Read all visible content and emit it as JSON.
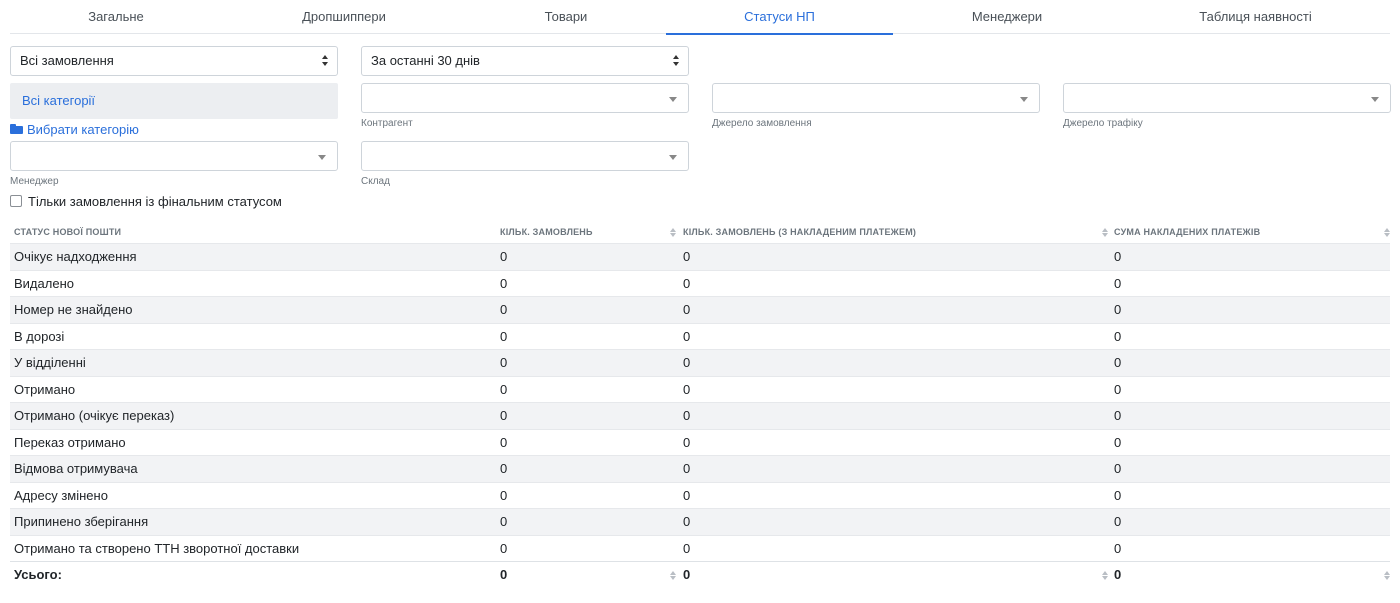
{
  "tabs": [
    {
      "label": "Загальне",
      "active": false
    },
    {
      "label": "Дропшиппери",
      "active": false
    },
    {
      "label": "Товари",
      "active": false
    },
    {
      "label": "Статуси НП",
      "active": true
    },
    {
      "label": "Менеджери",
      "active": false
    },
    {
      "label": "Таблиця наявності",
      "active": false
    }
  ],
  "filters": {
    "orders_select": "Всі замовлення",
    "period_select": "За останні 30 днів",
    "categories": "Всі категорії",
    "choose_category": "Вибрати категорію",
    "counterparty_label": "Контрагент",
    "order_source_label": "Джерело замовлення",
    "traffic_source_label": "Джерело трафіку",
    "manager_label": "Менеджер",
    "warehouse_label": "Склад",
    "final_status_checkbox": "Тільки замовлення із фінальним статусом"
  },
  "table": {
    "columns": [
      "Статус нової пошти",
      "Кільк. замовлень",
      "Кільк. замовлень (з накладеним платежем)",
      "Сума накладених платежів"
    ],
    "rows": [
      [
        "Очікує надходження",
        "0",
        "0",
        "0"
      ],
      [
        "Видалено",
        "0",
        "0",
        "0"
      ],
      [
        "Номер не знайдено",
        "0",
        "0",
        "0"
      ],
      [
        "В дорозі",
        "0",
        "0",
        "0"
      ],
      [
        "У відділенні",
        "0",
        "0",
        "0"
      ],
      [
        "Отримано",
        "0",
        "0",
        "0"
      ],
      [
        "Отримано (очікує переказ)",
        "0",
        "0",
        "0"
      ],
      [
        "Переказ отримано",
        "0",
        "0",
        "0"
      ],
      [
        "Відмова отримувача",
        "0",
        "0",
        "0"
      ],
      [
        "Адресу змінено",
        "0",
        "0",
        "0"
      ],
      [
        "Припинено зберігання",
        "0",
        "0",
        "0"
      ],
      [
        "Отримано та створено ТТН зворотної доставки",
        "0",
        "0",
        "0"
      ]
    ],
    "total": [
      "Усього:",
      "0",
      "0",
      "0"
    ]
  },
  "colors": {
    "accent": "#2a6fdb",
    "stripe": "#f2f3f5",
    "muted": "#6c757d"
  }
}
